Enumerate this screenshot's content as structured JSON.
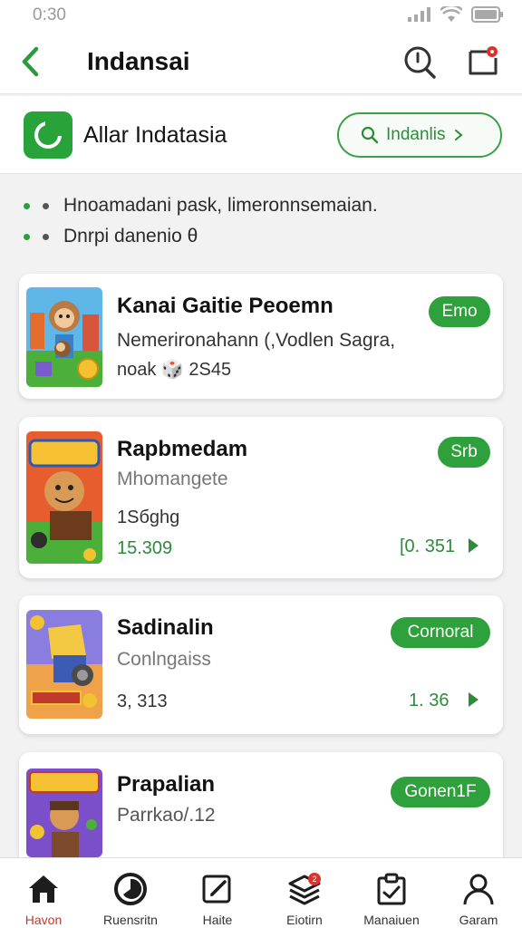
{
  "status_bar": {
    "time": "0:30"
  },
  "header": {
    "title": "Indansai"
  },
  "brand": {
    "name": "Allar Indatasia",
    "search_label": "Indanlis"
  },
  "bullets": [
    "Hnoamadani pask, limeronnsemaian.",
    "Dnrpi danenio θ"
  ],
  "cards": [
    {
      "title": "Kanai Gaitie Peoemn",
      "subtitle": "Nemerironahann (,Vodlen Sagra,",
      "meta": "noak 🎲 2S45",
      "badge": "Emo"
    },
    {
      "title": "Rapbmedam",
      "subtitle": "Mhomangete",
      "meta": "1Sбghg",
      "stat": "15.309",
      "badge": "Srb",
      "price": "[0. 351"
    },
    {
      "title": "Sadinalin",
      "subtitle": "Conlngaiss",
      "stat": "3, 313",
      "badge": "Cornoral",
      "price": "1. 36"
    },
    {
      "title": "Prapalian",
      "subtitle": "Parrkao/.12",
      "badge": "Gonen1F"
    }
  ],
  "bottom_nav": [
    {
      "label": "Havon",
      "icon": "home-icon",
      "active": true
    },
    {
      "label": "Ruensritn",
      "icon": "timer-icon"
    },
    {
      "label": "Haite",
      "icon": "edit-icon"
    },
    {
      "label": "Eiotirn",
      "icon": "layers-icon",
      "badge": "2"
    },
    {
      "label": "Manaiuen",
      "icon": "clipboard-icon"
    },
    {
      "label": "Garam",
      "icon": "profile-icon"
    }
  ],
  "colors": {
    "accent": "#2ea03c",
    "badge": "#e0302b",
    "active_nav": "#c0392b"
  }
}
